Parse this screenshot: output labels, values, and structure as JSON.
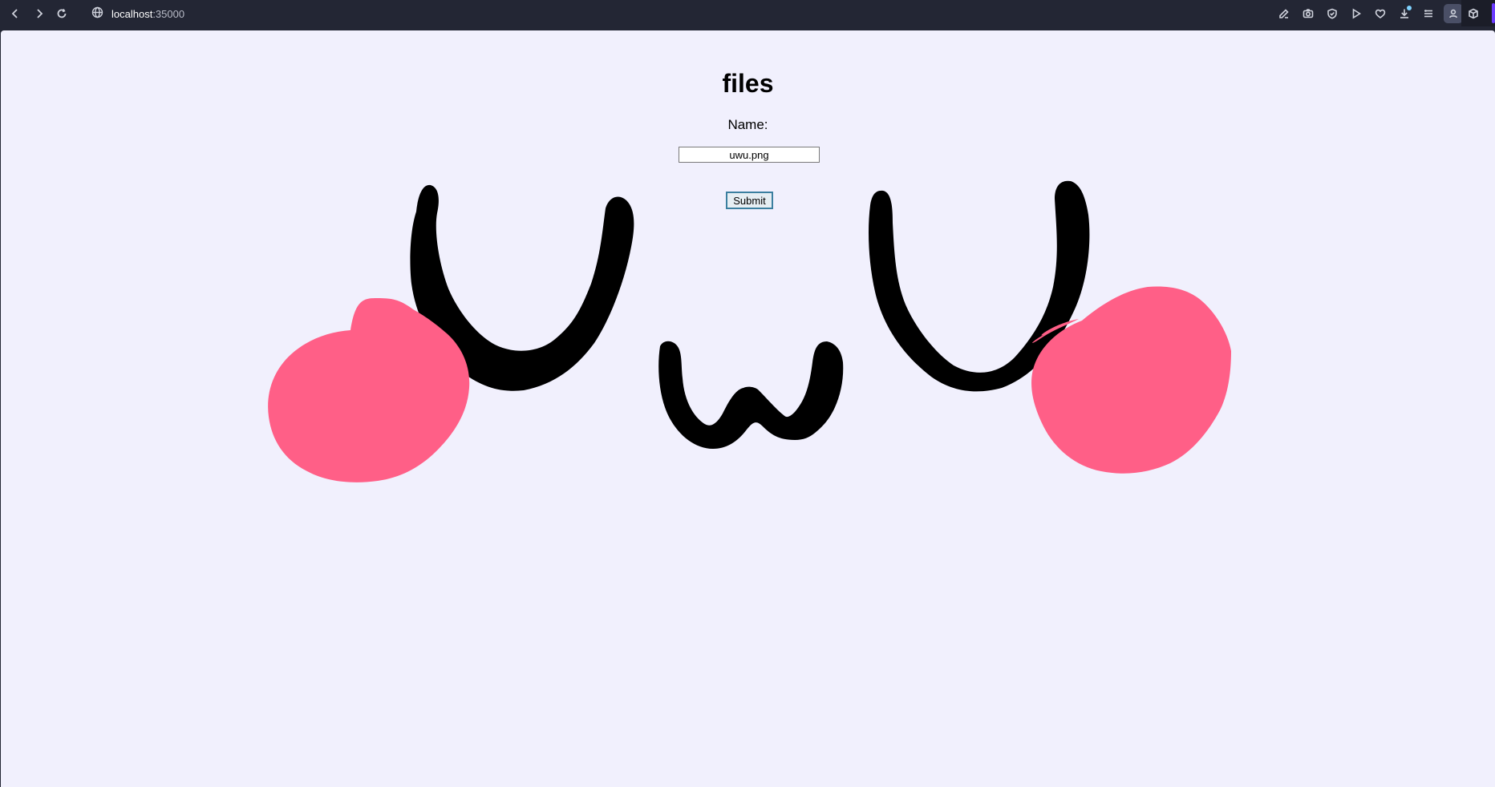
{
  "browser": {
    "url_host": "localhost",
    "url_port": ":35000",
    "icons": {
      "back": "chevron-left-icon",
      "forward": "chevron-right-icon",
      "reload": "reload-icon",
      "site_info": "globe-icon",
      "edit": "edit-icon",
      "screenshot": "camera-icon",
      "shield": "shield-icon",
      "play": "play-icon",
      "favorite": "heart-icon",
      "downloads": "download-icon",
      "menu": "menu-icon",
      "profile": "profile-icon",
      "extensions": "cube-icon"
    }
  },
  "page": {
    "title": "files",
    "name_label": "Name:",
    "name_value": "uwu.png",
    "submit_label": "Submit"
  },
  "colors": {
    "page_background": "#f1f0fd",
    "blush": "#ff5f87",
    "ink": "#000000",
    "browser_chrome": "#232634"
  }
}
